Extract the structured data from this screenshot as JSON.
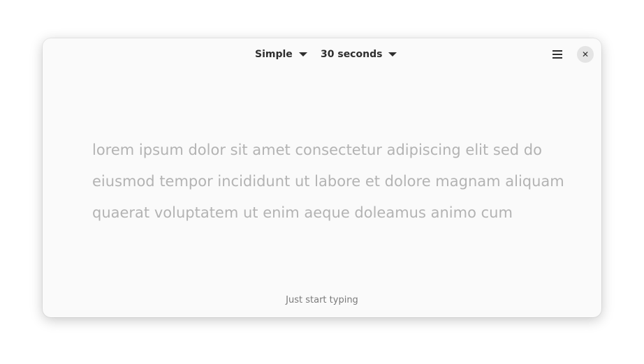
{
  "header": {
    "mode_label": "Simple",
    "duration_label": "30 seconds",
    "menu_icon": "hamburger-icon",
    "close_icon": "close-icon",
    "close_glyph": "✕"
  },
  "main": {
    "lines": [
      "lorem ipsum dolor sit amet consectetur adipiscing elit sed do",
      "eiusmod tempor incididunt ut labore et dolore magnam aliquam",
      "quaerat voluptatem ut enim aeque doleamus animo cum"
    ],
    "hint": "Just start typing"
  }
}
